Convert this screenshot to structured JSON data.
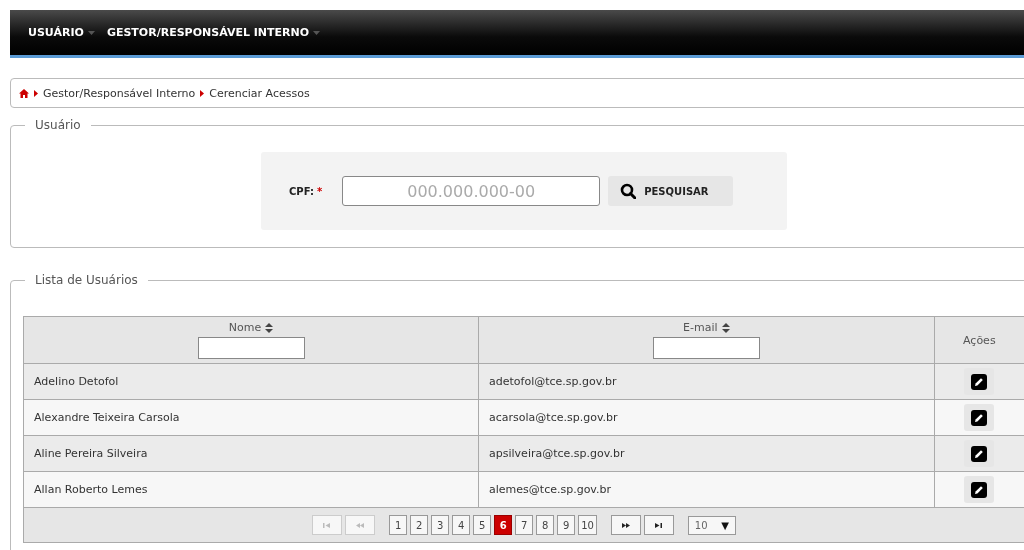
{
  "nav": {
    "menus": [
      {
        "label": "USUÁRIO"
      },
      {
        "label": "GESTOR/RESPONSÁVEL INTERNO"
      }
    ]
  },
  "breadcrumb": {
    "items": [
      "Gestor/Responsável Interno",
      "Cerenciar Acessos"
    ]
  },
  "user_section": {
    "legend": "Usuário",
    "cpf_label": "CPF:",
    "required_mark": "*",
    "cpf_field": {
      "placeholder": "000.000.000-00"
    },
    "search_button": "PESQUISAR"
  },
  "list_section": {
    "legend": "Lista de Usuários",
    "table": {
      "columns": [
        {
          "label": "Nome",
          "sortable": true,
          "filter": true
        },
        {
          "label": "E-mail",
          "sortable": true,
          "filter": true
        },
        {
          "label": "Ações",
          "sortable": false,
          "filter": false
        }
      ],
      "rows": [
        {
          "name": "Adelino Detofol",
          "email": "adetofol@tce.sp.gov.br"
        },
        {
          "name": "Alexandre Teixeira Carsola",
          "email": "acarsola@tce.sp.gov.br"
        },
        {
          "name": "Aline Pereira Silveira",
          "email": "apsilveira@tce.sp.gov.br"
        },
        {
          "name": "Allan Roberto Lemes",
          "email": "alemes@tce.sp.gov.br"
        }
      ]
    },
    "pager": {
      "nav_before": [
        {
          "kind": "first",
          "disabled": true
        },
        {
          "kind": "prev",
          "disabled": true
        }
      ],
      "pages": [
        {
          "label": "1",
          "selected": false
        },
        {
          "label": "2",
          "selected": false
        },
        {
          "label": "3",
          "selected": false
        },
        {
          "label": "4",
          "selected": false
        },
        {
          "label": "5",
          "selected": false
        },
        {
          "label": "6",
          "selected": true
        },
        {
          "label": "7",
          "selected": false
        },
        {
          "label": "8",
          "selected": false
        },
        {
          "label": "9",
          "selected": false
        },
        {
          "label": "10",
          "selected": false
        }
      ],
      "nav_after": [
        {
          "kind": "next",
          "disabled": false
        },
        {
          "kind": "last",
          "disabled": false
        }
      ],
      "page_size": "10",
      "page_size_arrow": "▼"
    }
  }
}
